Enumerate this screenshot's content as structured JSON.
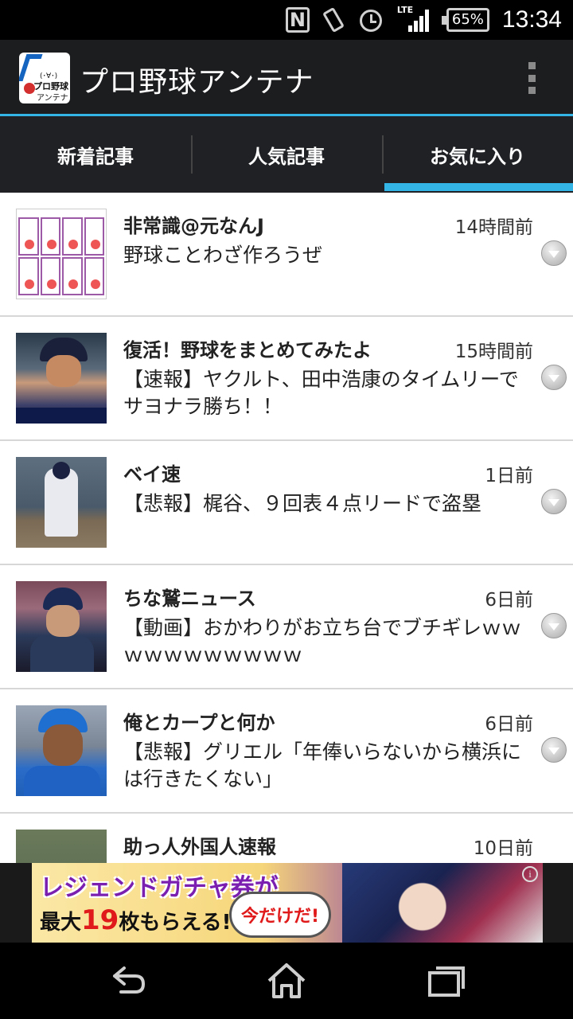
{
  "status_bar": {
    "nfc_icon": "nfc-icon",
    "vibrate_icon": "vibrate-icon",
    "alarm_icon": "alarm-icon",
    "network": "LTE",
    "battery": "65%",
    "time": "13:34"
  },
  "app": {
    "title": "プロ野球アンテナ",
    "icon_face": "(･∀･)",
    "icon_line1": "プロ野球",
    "icon_line2": "アンテナ"
  },
  "tabs": [
    {
      "label": "新着記事",
      "selected": false
    },
    {
      "label": "人気記事",
      "selected": false
    },
    {
      "label": "お気に入り",
      "selected": true
    }
  ],
  "articles": [
    {
      "source": "非常識@元なんJ",
      "time": "14時間前",
      "title": "野球ことわざ作ろうぜ"
    },
    {
      "source": "復活！野球をまとめてみたよ",
      "time": "15時間前",
      "title": "【速報】ヤクルト、田中浩康のタイムリーでサヨナラ勝ち！！"
    },
    {
      "source": "ベイ速",
      "time": "1日前",
      "title": "【悲報】梶谷、９回表４点リードで盗塁"
    },
    {
      "source": "ちな鷲ニュース",
      "time": "6日前",
      "title": "【動画】おかわりがお立ち台でブチギレｗｗｗｗｗｗｗｗｗｗｗ"
    },
    {
      "source": "俺とカープと何か",
      "time": "6日前",
      "title": "【悲報】グリエル「年俸いらないから横浜には行きたくない」"
    },
    {
      "source": "助っ人外国人速報",
      "time": "10日前",
      "title": ""
    }
  ],
  "ad": {
    "line1": "レジェンドガチャ券が",
    "line2_prefix": "最大",
    "line2_number": "19",
    "line2_suffix": "枚もらえる!",
    "bubble": "今だけだ!",
    "info": "i"
  },
  "colors": {
    "accent": "#33b5e5",
    "action_bar": "#1c1d1f",
    "tab_bar": "#1f2124"
  }
}
